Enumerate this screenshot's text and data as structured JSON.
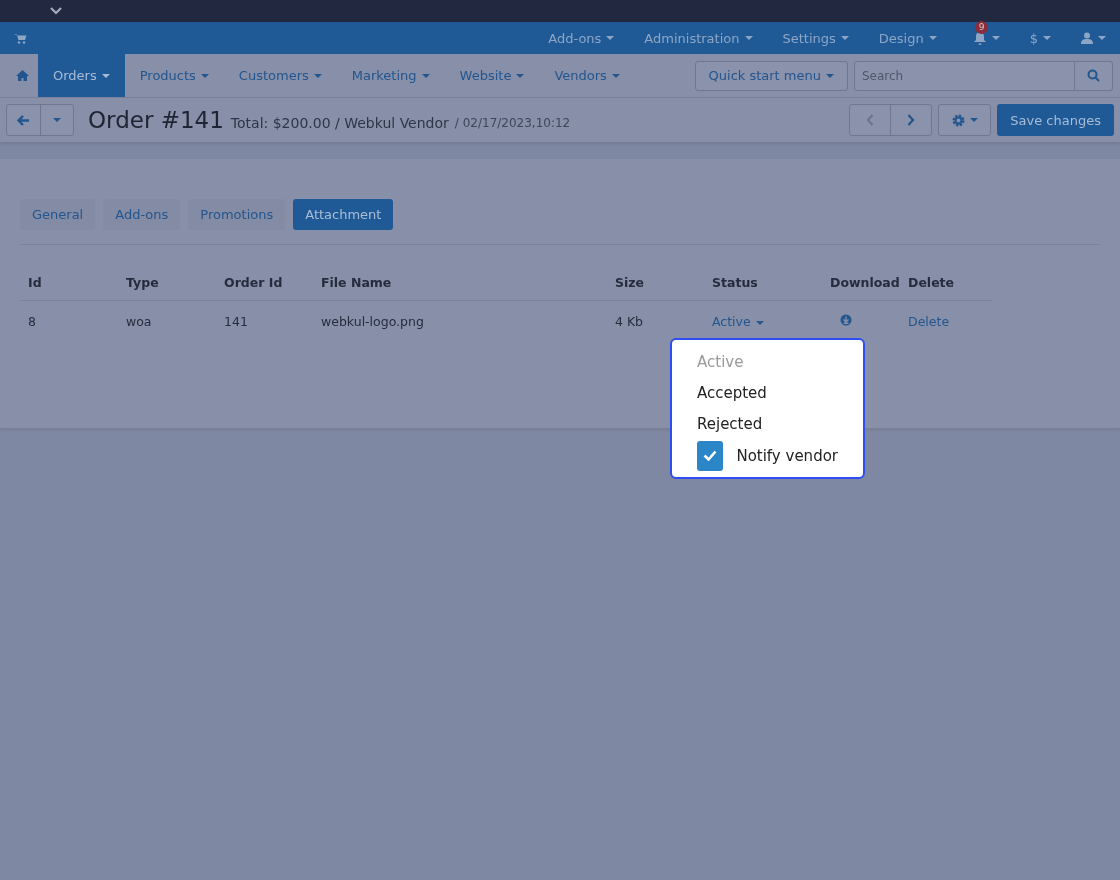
{
  "top_bar": {
    "menus": [
      {
        "label": "Add-ons"
      },
      {
        "label": "Administration"
      },
      {
        "label": "Settings"
      },
      {
        "label": "Design"
      }
    ],
    "notification_count": "9",
    "currency": "$"
  },
  "nav": {
    "items": [
      {
        "label": "Orders",
        "selected": true
      },
      {
        "label": "Products",
        "selected": false
      },
      {
        "label": "Customers",
        "selected": false
      },
      {
        "label": "Marketing",
        "selected": false
      },
      {
        "label": "Website",
        "selected": false
      },
      {
        "label": "Vendors",
        "selected": false
      }
    ],
    "quick_start": "Quick start menu",
    "search": {
      "placeholder": "Search"
    }
  },
  "header": {
    "title": "Order #141",
    "total": "Total: $200.00 / Webkul Vendor",
    "date": "/ 02/17/2023,10:12",
    "save_button": "Save changes"
  },
  "tabs": [
    {
      "label": "General",
      "selected": false
    },
    {
      "label": "Add-ons",
      "selected": false
    },
    {
      "label": "Promotions",
      "selected": false
    },
    {
      "label": "Attachment",
      "selected": true
    }
  ],
  "table": {
    "columns": [
      "Id",
      "Type",
      "Order Id",
      "File Name",
      "Size",
      "Status",
      "Download",
      "Delete"
    ],
    "rows": [
      {
        "id": "8",
        "type": "woa",
        "order_id": "141",
        "file_name": "webkul-logo.png",
        "size": "4 Kb",
        "status": "Active",
        "delete": "Delete"
      }
    ]
  },
  "status_menu": {
    "options": [
      {
        "label": "Active",
        "disabled": true
      },
      {
        "label": "Accepted",
        "disabled": false
      },
      {
        "label": "Rejected",
        "disabled": false
      }
    ],
    "notify_vendor": {
      "label": "Notify vendor",
      "checked": true
    }
  }
}
